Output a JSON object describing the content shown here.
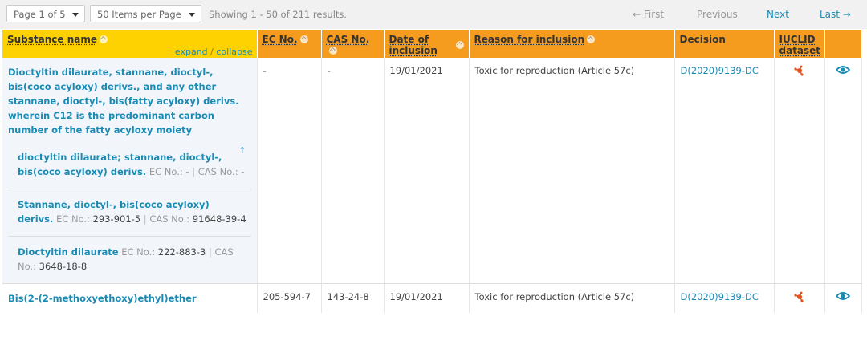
{
  "pager": {
    "page_select": "Page 1 of 5",
    "items_select": "50 Items per Page",
    "showing": "Showing 1 - 50 of 211 results.",
    "first": "← First",
    "previous": "Previous",
    "next": "Next",
    "last": "Last →"
  },
  "columns": {
    "substance": "Substance name",
    "expand": "expand",
    "slash": "/",
    "collapse": "collapse",
    "ec": "EC No.",
    "cas": "CAS No.",
    "date": "Date of inclusion",
    "reason": "Reason for inclusion",
    "decision": "Decision",
    "iuclid": "IUCLID dataset"
  },
  "rows": [
    {
      "name": "Dioctyltin dilaurate, stannane, dioctyl-, bis(coco acyloxy) derivs., and any other stannane, dioctyl-, bis(fatty acyloxy) derivs. wherein C12 is the predominant carbon number of the fatty acyloxy moiety",
      "ec": "-",
      "cas": "-",
      "date": "19/01/2021",
      "reason": "Toxic for reproduction (Article 57c)",
      "decision": "D(2020)9139-DC",
      "subs": [
        {
          "name": "dioctyltin dilaurate; stannane, dioctyl-, bis(coco acyloxy) derivs.",
          "ec_label": "EC No.:",
          "ec": "-",
          "sep": "|",
          "cas_label": "CAS No.:",
          "cas": "-",
          "up": "↑"
        },
        {
          "name": "Stannane, dioctyl-, bis(coco acyloxy) derivs.",
          "ec_label": "EC No.:",
          "ec": "293-901-5",
          "sep": "|",
          "cas_label": "CAS No.:",
          "cas": "91648-39-4"
        },
        {
          "name": "Dioctyltin dilaurate",
          "ec_label": "EC No.:",
          "ec": "222-883-3",
          "sep": "|",
          "cas_label": "CAS No.:",
          "cas": "3648-18-8"
        }
      ]
    },
    {
      "name": "Bis(2-(2-methoxyethoxy)ethyl)ether",
      "ec": "205-594-7",
      "cas": "143-24-8",
      "date": "19/01/2021",
      "reason": "Toxic for reproduction (Article 57c)",
      "decision": "D(2020)9139-DC"
    }
  ],
  "colors": {
    "yellow_header": "#fdd200",
    "orange_header": "#f59c1f",
    "link": "#1a8bb3",
    "icon": "#e5531d"
  },
  "icons": {
    "iuclid": "molecule-icon",
    "view": "eye-icon"
  }
}
